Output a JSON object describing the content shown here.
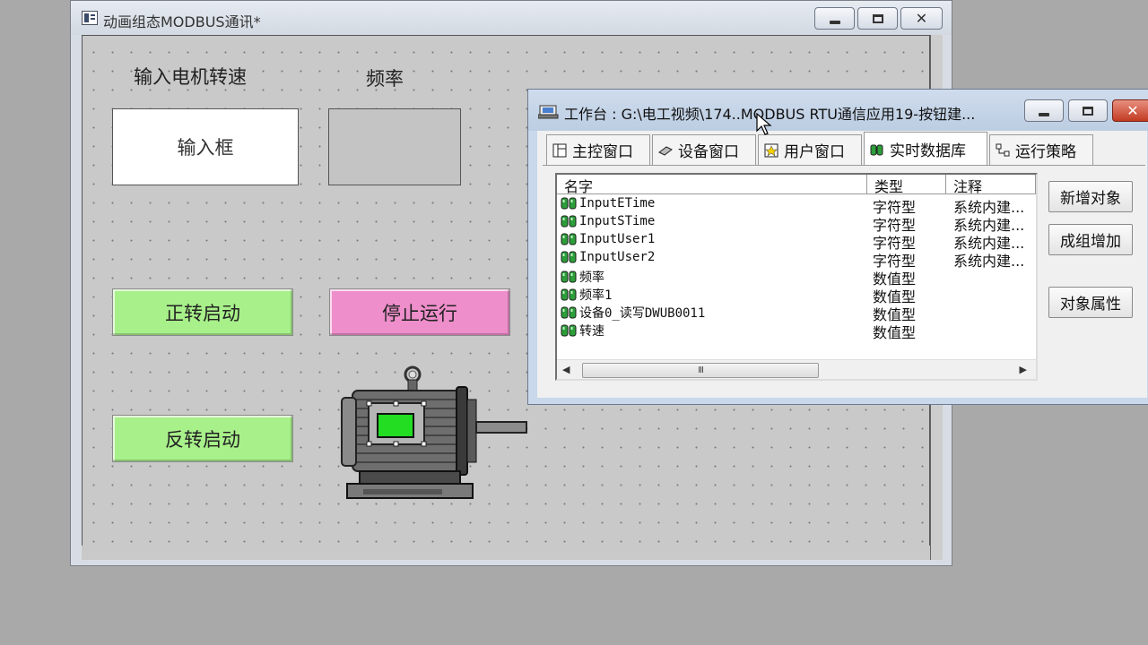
{
  "design_window": {
    "title": "动画组态MODBUS通讯*",
    "labels": {
      "speed_input": "输入电机转速",
      "frequency": "频率"
    },
    "input_box_text": "输入框",
    "buttons": {
      "forward": "正转启动",
      "stop": "停止运行",
      "reverse": "反转启动"
    }
  },
  "workbench": {
    "title": "工作台 : G:\\电工视频\\174..MODBUS RTU通信应用19-按钮建...",
    "tabs": [
      {
        "label": "主控窗口",
        "icon": "main-window-icon"
      },
      {
        "label": "设备窗口",
        "icon": "device-window-icon"
      },
      {
        "label": "用户窗口",
        "icon": "user-window-icon"
      },
      {
        "label": "实时数据库",
        "icon": "database-icon",
        "active": true
      },
      {
        "label": "运行策略",
        "icon": "strategy-icon"
      }
    ],
    "columns": [
      "名字",
      "类型",
      "注释"
    ],
    "rows": [
      {
        "name": "InputETime",
        "type": "字符型",
        "note": "系统内建..."
      },
      {
        "name": "InputSTime",
        "type": "字符型",
        "note": "系统内建..."
      },
      {
        "name": "InputUser1",
        "type": "字符型",
        "note": "系统内建..."
      },
      {
        "name": "InputUser2",
        "type": "字符型",
        "note": "系统内建..."
      },
      {
        "name": "频率",
        "type": "数值型",
        "note": ""
      },
      {
        "name": "频率1",
        "type": "数值型",
        "note": ""
      },
      {
        "name": "设备0_读写DWUB0011",
        "type": "数值型",
        "note": ""
      },
      {
        "name": "转速",
        "type": "数值型",
        "note": ""
      }
    ],
    "scroll_thumb_text": "III",
    "side_buttons": {
      "new_object": "新增对象",
      "group_add": "成组增加",
      "object_properties": "对象属性"
    }
  },
  "colors": {
    "green_button": "#a8f08a",
    "pink_button": "#ee8ecb",
    "motor_display": "#22dd22"
  }
}
